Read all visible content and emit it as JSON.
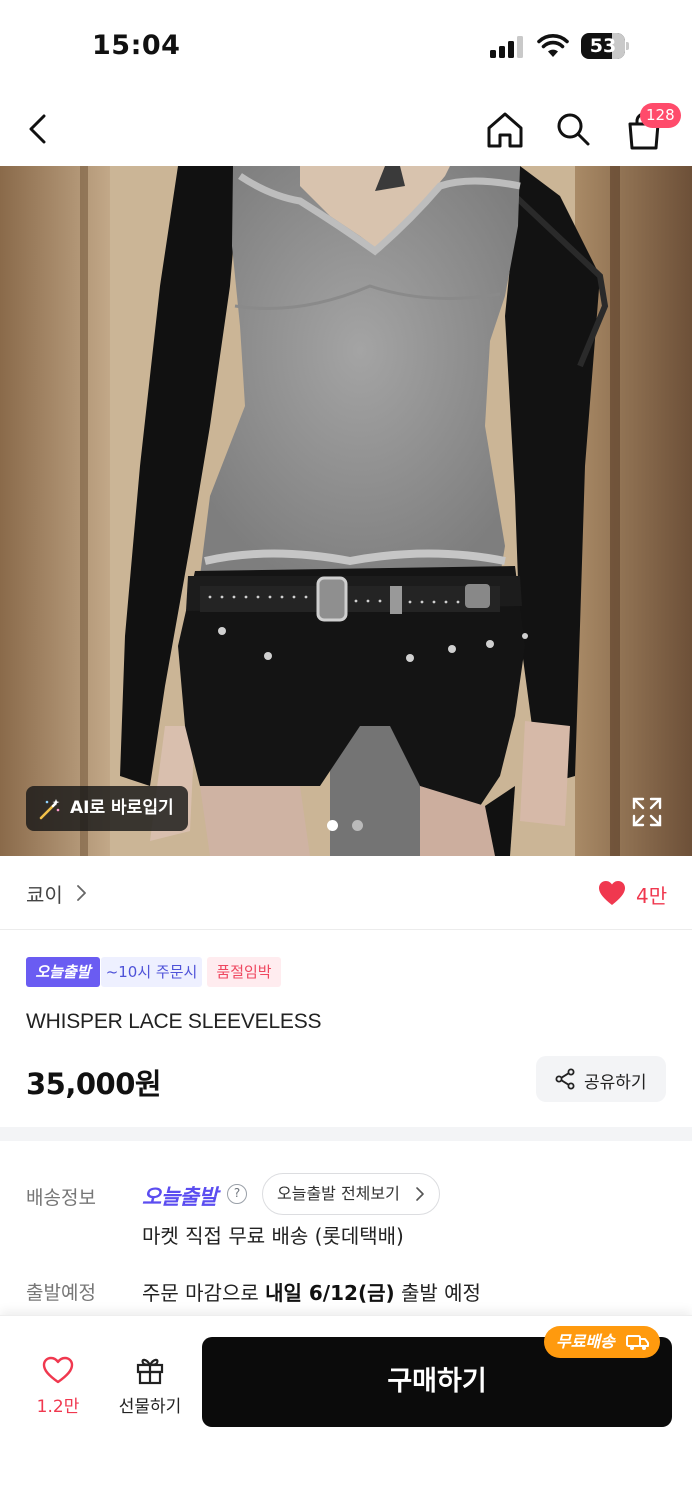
{
  "status_bar": {
    "time": "15:04",
    "battery": "53"
  },
  "nav": {
    "cart_count": "128"
  },
  "hero": {
    "ai_button_label": "AI로 바로입기",
    "page_count": 2,
    "current_page": 1
  },
  "store": {
    "name": "쿄이",
    "likes": "4만"
  },
  "badges": {
    "today_ship": "오늘출발",
    "order_by": "~10시 주문시",
    "low_stock": "품절임박"
  },
  "product": {
    "name": "WHISPER LACE SLEEVELESS",
    "price": "35,000원"
  },
  "share": {
    "label": "공유하기"
  },
  "shipping": {
    "label": "배송정보",
    "brand": "오늘출발",
    "help": "?",
    "view_all_label": "오늘출발 전체보기",
    "description": "마켓 직접 무료 배송 (롯데택배)"
  },
  "departure": {
    "label": "출발예정",
    "prefix": "주문 마감으로",
    "date": "내일 6/12(금)",
    "suffix": "출발 예정"
  },
  "bottom": {
    "like_count": "1.2만",
    "gift_label": "선물하기",
    "buy_label": "구매하기",
    "free_shipping_tag": "무료배송"
  },
  "colors": {
    "accent_pink": "#f0384f",
    "brand_purple": "#6a5cf2",
    "free_ship_orange": "#ff9a0e"
  }
}
